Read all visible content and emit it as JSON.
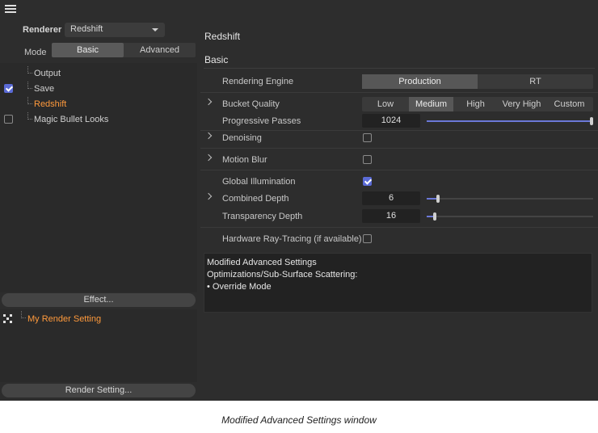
{
  "left": {
    "renderer_label": "Renderer",
    "renderer_value": "Redshift",
    "mode_label": "Mode",
    "mode_tabs": [
      "Basic",
      "Advanced"
    ],
    "mode_active": "Basic",
    "tree": [
      {
        "label": "Output",
        "checkbox": null,
        "selected": false
      },
      {
        "label": "Save",
        "checkbox": true,
        "selected": false
      },
      {
        "label": "Redshift",
        "checkbox": null,
        "selected": true
      },
      {
        "label": "Magic Bullet Looks",
        "checkbox": false,
        "selected": false
      }
    ],
    "effect_button": "Effect...",
    "render_settings": [
      "My Render Setting"
    ],
    "render_setting_button": "Render Setting..."
  },
  "right": {
    "title": "Redshift",
    "section": "Basic",
    "rendering_engine": {
      "label": "Rendering Engine",
      "options": [
        "Production",
        "RT"
      ],
      "active": "Production"
    },
    "bucket_quality": {
      "label": "Bucket Quality",
      "options": [
        "Low",
        "Medium",
        "High",
        "Very High",
        "Custom"
      ],
      "active": "Medium"
    },
    "progressive_passes": {
      "label": "Progressive Passes",
      "value": "1024",
      "fraction": 1.0
    },
    "denoising": {
      "label": "Denoising",
      "checked": false
    },
    "motion_blur": {
      "label": "Motion Blur",
      "checked": false
    },
    "global_illumination": {
      "label": "Global Illumination",
      "checked": true
    },
    "combined_depth": {
      "label": "Combined Depth",
      "value": "6",
      "fraction": 0.07
    },
    "transparency_depth": {
      "label": "Transparency Depth",
      "value": "16",
      "fraction": 0.05
    },
    "hardware_rt": {
      "label": "Hardware Ray-Tracing (if available)",
      "checked": false
    },
    "info_lines": [
      "Modified Advanced Settings",
      "Optimizations/Sub-Surface Scattering:",
      "• Override Mode"
    ]
  },
  "caption": "Modified Advanced Settings window",
  "colors": {
    "accent": "#5b6bd6",
    "selected_text": "#ff9a3c"
  }
}
